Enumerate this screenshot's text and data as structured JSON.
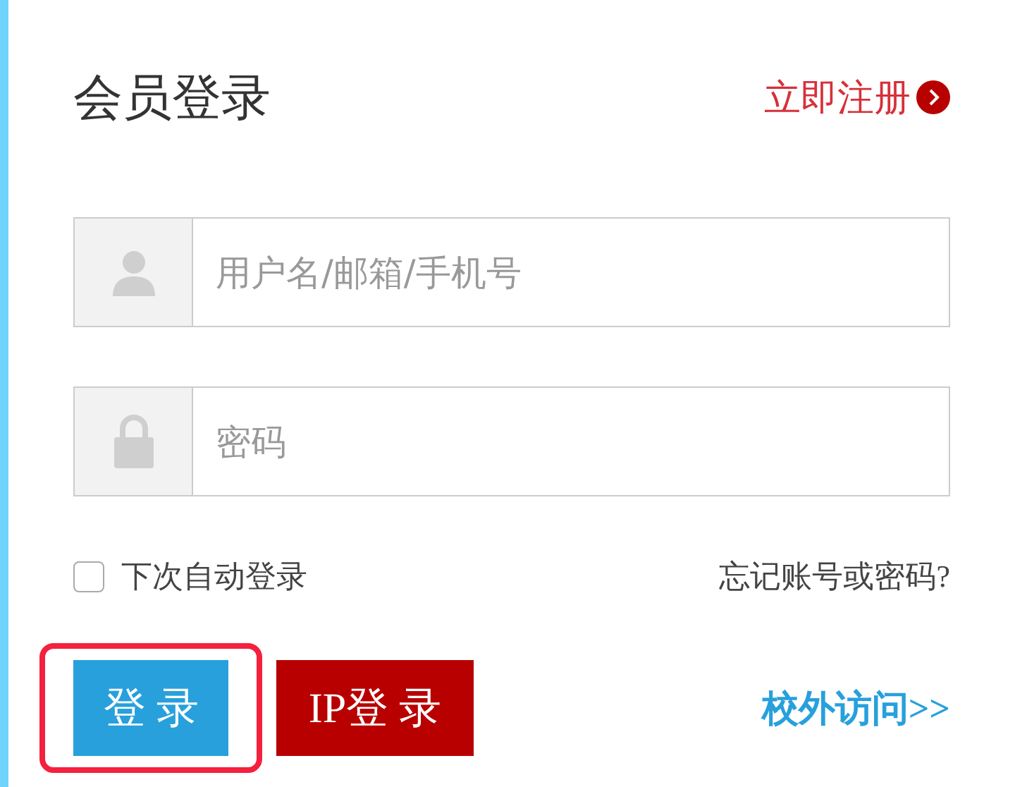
{
  "title": "会员登录",
  "register_link": {
    "label": "立即注册"
  },
  "fields": [
    {
      "kind": "user",
      "placeholder": "用户名/邮箱/手机号"
    },
    {
      "kind": "password",
      "placeholder": "密码"
    }
  ],
  "remember": {
    "label": "下次自动登录",
    "checked": false
  },
  "forgot_link": "忘记账号或密码?",
  "buttons": [
    {
      "kind": "login",
      "label": "登 录",
      "highlighted": true
    },
    {
      "kind": "ip",
      "label": "IP登 录",
      "highlighted": false
    }
  ],
  "offcampus_link": "校外访问>>"
}
